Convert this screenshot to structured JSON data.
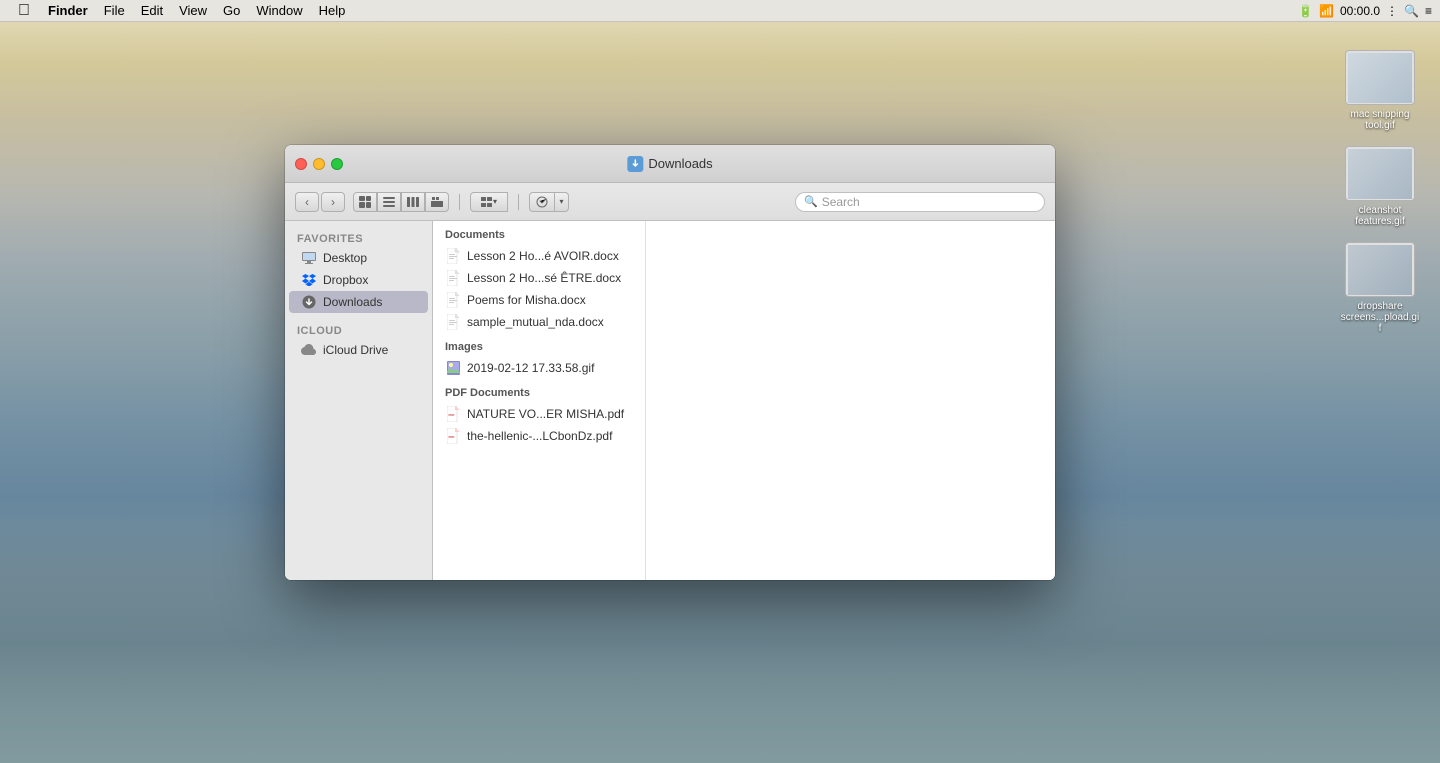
{
  "menubar": {
    "apple": "",
    "items": [
      "Finder",
      "File",
      "Edit",
      "View",
      "Go",
      "Window",
      "Help"
    ],
    "right_items": {
      "time": "00:00.0",
      "battery_icon": "battery-icon",
      "wifi_icon": "wifi-icon",
      "search_icon": "search-icon",
      "control_icon": "control-center-icon"
    }
  },
  "window": {
    "title": "Downloads",
    "controls": {
      "close": "close",
      "minimize": "minimize",
      "maximize": "maximize"
    }
  },
  "toolbar": {
    "back_label": "‹",
    "forward_label": "›",
    "search_placeholder": "Search"
  },
  "sidebar": {
    "favorites_label": "Favorites",
    "favorites_items": [
      {
        "id": "desktop",
        "label": "Desktop",
        "icon": "desktop-icon"
      },
      {
        "id": "dropbox",
        "label": "Dropbox",
        "icon": "dropbox-icon"
      },
      {
        "id": "downloads",
        "label": "Downloads",
        "icon": "downloads-icon"
      }
    ],
    "icloud_label": "iCloud",
    "icloud_items": [
      {
        "id": "icloud-drive",
        "label": "iCloud Drive",
        "icon": "cloud-icon"
      }
    ]
  },
  "files": {
    "groups": [
      {
        "id": "documents",
        "label": "Documents",
        "items": [
          {
            "name": "Lesson 2 Ho...é AVOIR.docx",
            "icon": "docx-icon"
          },
          {
            "name": "Lesson 2 Ho...sé ÊTRE.docx",
            "icon": "docx-icon"
          },
          {
            "name": "Poems for Misha.docx",
            "icon": "docx-icon"
          },
          {
            "name": "sample_mutual_nda.docx",
            "icon": "docx-icon"
          }
        ]
      },
      {
        "id": "images",
        "label": "Images",
        "items": [
          {
            "name": "2019-02-12 17.33.58.gif",
            "icon": "gif-icon"
          }
        ]
      },
      {
        "id": "pdf-documents",
        "label": "PDF Documents",
        "items": [
          {
            "name": "NATURE VO...ER MISHA.pdf",
            "icon": "pdf-icon"
          },
          {
            "name": "the-hellenic-...LCbonDz.pdf",
            "icon": "pdf-icon"
          }
        ]
      }
    ]
  },
  "desktop_icons": [
    {
      "label": "mac snipping tool.gif",
      "id": "mac-snipping-gif"
    },
    {
      "label": "cleanshot features.gif",
      "id": "cleanshot-gif"
    },
    {
      "label": "dropshare screens...pload.gif",
      "id": "dropshare-gif"
    }
  ]
}
